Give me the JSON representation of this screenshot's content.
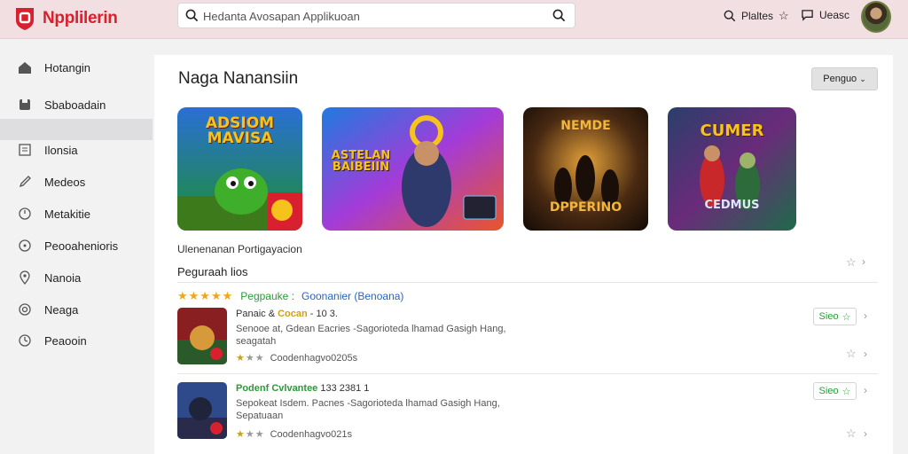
{
  "app": {
    "name": "Npplilerin",
    "brand_color": "#d9202f"
  },
  "search": {
    "placeholder": "Hedanta Avosapan Applikuoan"
  },
  "top_actions": {
    "plates_label": "Plaltes",
    "user_label": "Ueasc"
  },
  "sidebar": {
    "items": [
      {
        "label": "Hotangin",
        "icon": "home-icon"
      },
      {
        "label": "Sbaboadain",
        "icon": "library-icon"
      },
      {
        "label": "Ilonsia",
        "icon": "list-icon"
      },
      {
        "label": "Medeos",
        "icon": "pencil-icon"
      },
      {
        "label": "Metakitie",
        "icon": "clock-icon"
      },
      {
        "label": "Peooahenioris",
        "icon": "circle-icon"
      },
      {
        "label": "Nanoia",
        "icon": "pin-icon"
      },
      {
        "label": "Neaga",
        "icon": "target-icon"
      },
      {
        "label": "Peaooin",
        "icon": "clock-icon"
      }
    ],
    "selected_index": 2
  },
  "main": {
    "title": "Naga Nanansiin",
    "dropdown_label": "Penguo",
    "tiles": [
      {
        "title": "ADSIOM MAVISA"
      },
      {
        "title": "ASTELAN BAIBEIIN"
      },
      {
        "title": "NEMDE",
        "subtitle": "DPPERINO"
      },
      {
        "title": "CUMER",
        "subtitle": "CEDMUS"
      }
    ],
    "section_label": "Ulenenanan  Portigayacion",
    "section_heading": "Peguraah lios",
    "rating_line": {
      "stars": "★★★★★",
      "green_text": "Pegpauke :",
      "blue_text": "Goonanier (Benoana)"
    },
    "apps": [
      {
        "name_white": "Panaic &",
        "name_yellow": "Cocan",
        "name_rest": "- 10 3.",
        "description": "Senooe at, Gdean Eacries -Sagorioteda lhamad Gasigh Hang, seagatah",
        "rating_text": "Coodenhagvo0205s",
        "get_label": "Sieo"
      },
      {
        "name_green": "Podenf Cvlvantee",
        "name_rest": "133 2381 1",
        "description": "Sepokeat Isdem. Pacnes -Sagorioteda lhamad Gasigh Hang, Sepatuaan",
        "rating_text": "Coodenhagvo021s",
        "get_label": "Sieo"
      }
    ]
  }
}
